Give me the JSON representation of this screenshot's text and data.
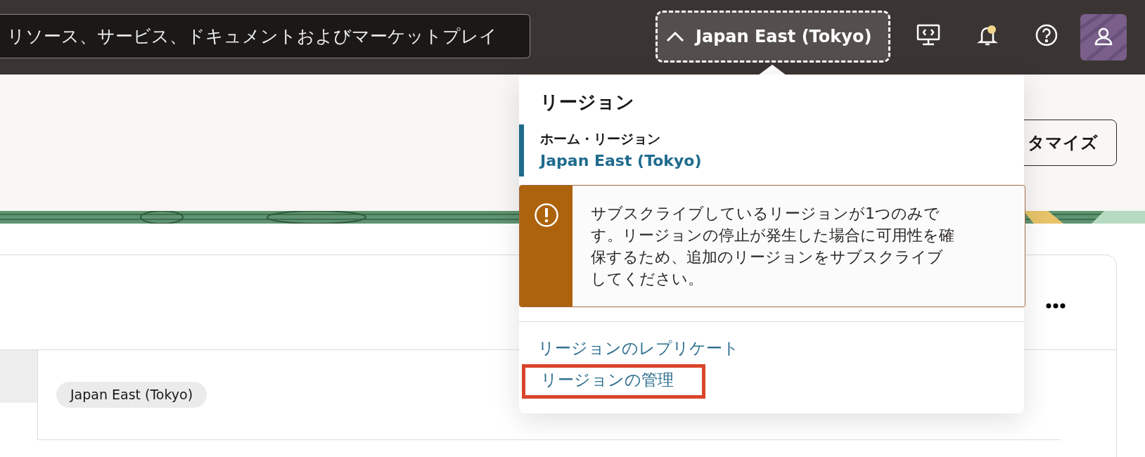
{
  "top_bar": {
    "search": {
      "placeholder": "リソース、サービス、ドキュメントおよびマーケットプレイ"
    },
    "region_button": {
      "label": "Japan East (Tokyo)",
      "expanded": true
    },
    "notifications": {
      "unread": true
    }
  },
  "page": {
    "customize_button": {
      "label": "タマイズ"
    },
    "card": {
      "chip": "Japan East (Tokyo)"
    }
  },
  "region_popup": {
    "title": "リージョン",
    "home_label": "ホーム・リージョン",
    "home_region": "Japan East (Tokyo)",
    "warning": "サブスクライブしているリージョンが1つのみです。リージョンの停止が発生した場合に可用性を確保するため、追加のリージョンをサブスクライブしてください。",
    "links": [
      {
        "label": "リージョンのレプリケート",
        "highlighted": false
      },
      {
        "label": "リージョンの管理",
        "highlighted": true
      }
    ]
  }
}
